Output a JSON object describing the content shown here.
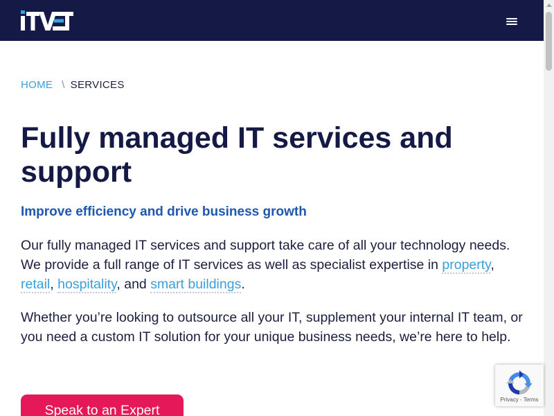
{
  "header": {
    "logo_text": "ITVET"
  },
  "breadcrumb": {
    "home": "HOME",
    "separator": "\\",
    "current": "SERVICES"
  },
  "main": {
    "title": "Fully managed IT services and support",
    "subtitle": "Improve efficiency and drive business growth",
    "para1": {
      "text_a": "Our fully managed IT services and support take care of all your technology needs. We provide a full range of IT services as well as specialist expertise in ",
      "link_property": "property",
      "sep1": ", ",
      "link_retail": "retail",
      "sep2": ", ",
      "link_hospitality": "hospitality",
      "sep3": ", and ",
      "link_smart_buildings": "smart buildings",
      "end": "."
    },
    "para2": "Whether you’re looking to outsource all your IT, supplement your internal IT team, or you need a custom IT solution for your unique business needs, we’re here to help.",
    "cta_label": "Speak to an Expert"
  },
  "recaptcha": {
    "privacy": "Privacy",
    "separator": " - ",
    "terms": "Terms"
  },
  "icons": {
    "logo": "itvet-logo",
    "menu": "hamburger-menu-icon",
    "recaptcha": "recaptcha-icon"
  },
  "colors": {
    "header_bg": "#141a45",
    "link": "#3a9fd8",
    "subtitle": "#1e57b0",
    "cta_bg": "#e5195a",
    "title": "#141a45"
  }
}
